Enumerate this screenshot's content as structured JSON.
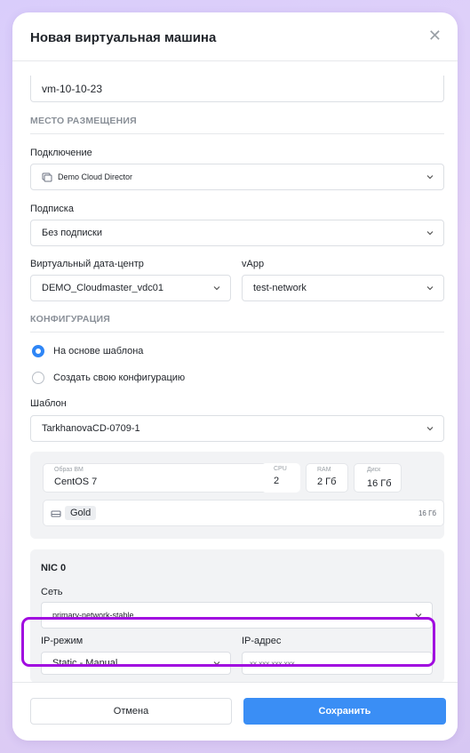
{
  "modal": {
    "title": "Новая виртуальная машина"
  },
  "name_value": "vm-10-10-23",
  "placement": {
    "section": "МЕСТО РАЗМЕЩЕНИЯ",
    "connection_label": "Подключение",
    "connection_value": "Demo Cloud Director",
    "subscription_label": "Подписка",
    "subscription_value": "Без подписки",
    "vdc_label": "Виртуальный дата-центр",
    "vdc_value": "DEMO_Cloudmaster_vdc01",
    "vapp_label": "vApp",
    "vapp_value": "test-network"
  },
  "config": {
    "section": "КОНФИГУРАЦИЯ",
    "radio_template": "На основе шаблона",
    "radio_custom": "Создать свою конфигурацию",
    "template_label": "Шаблон",
    "template_value": "TarkhanovaCD-0709-1",
    "image_label": "Образ ВМ",
    "image_value": "CentOS 7",
    "cpu_label": "CPU",
    "cpu_value": "2",
    "ram_label": "RAM",
    "ram_value": "2 Гб",
    "disk_label": "Диск",
    "disk_value": "16 Гб",
    "storage_tag": "Gold",
    "storage_size": "16 Гб"
  },
  "nic": {
    "title": "NIC 0",
    "network_label": "Сеть",
    "network_value": "primary-network-stable",
    "ip_mode_label": "IP-режим",
    "ip_mode_value": "Static - Manual",
    "ip_address_label": "IP-адрес",
    "ip_address_placeholder": "xx.xxx.xxx.xxx"
  },
  "footer": {
    "cancel": "Отмена",
    "save": "Сохранить"
  },
  "colors": {
    "accent": "#3a8ef5",
    "highlight": "#a10be0"
  },
  "icons": [
    "close-icon",
    "chevron-down-icon",
    "cloud-director-icon",
    "storage-icon"
  ]
}
